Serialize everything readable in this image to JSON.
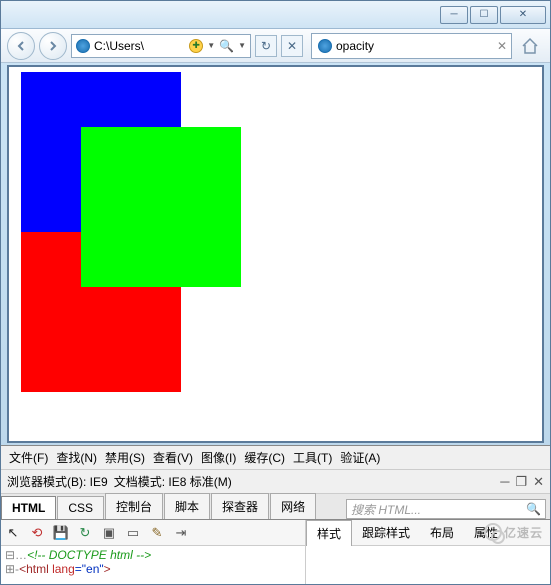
{
  "window": {
    "minimize": "─",
    "maximize": "☐",
    "close": "✕"
  },
  "nav": {
    "path": "C:\\Users\\",
    "tab_title": "opacity"
  },
  "content": {
    "squares": {
      "blue": "#0000ff",
      "green": "#00ff00",
      "red": "#ff0000"
    }
  },
  "devtools": {
    "menu": {
      "file": "文件(F)",
      "find": "查找(N)",
      "disable": "禁用(S)",
      "view": "查看(V)",
      "images": "图像(I)",
      "cache": "缓存(C)",
      "tools": "工具(T)",
      "validate": "验证(A)"
    },
    "mode": {
      "browser_mode": "浏览器模式(B): IE9",
      "doc_mode": "文档模式: IE8 标准(M)"
    },
    "tabs": {
      "html": "HTML",
      "css": "CSS",
      "console": "控制台",
      "script": "脚本",
      "profiler": "探查器",
      "network": "网络"
    },
    "search_placeholder": "搜索 HTML...",
    "right_tabs": {
      "style": "样式",
      "trace": "跟踪样式",
      "layout": "布局",
      "attrs": "属性"
    },
    "tree": {
      "line1_gutter": "⊟…",
      "line1": "<!-- DOCTYPE html -->",
      "line2_gutter": "⊞-",
      "line2_tag_open": "<html",
      "line2_attr": "lang",
      "line2_eq": "=",
      "line2_val": "\"en\"",
      "line2_tag_close": ">"
    }
  },
  "watermark": "亿速云"
}
